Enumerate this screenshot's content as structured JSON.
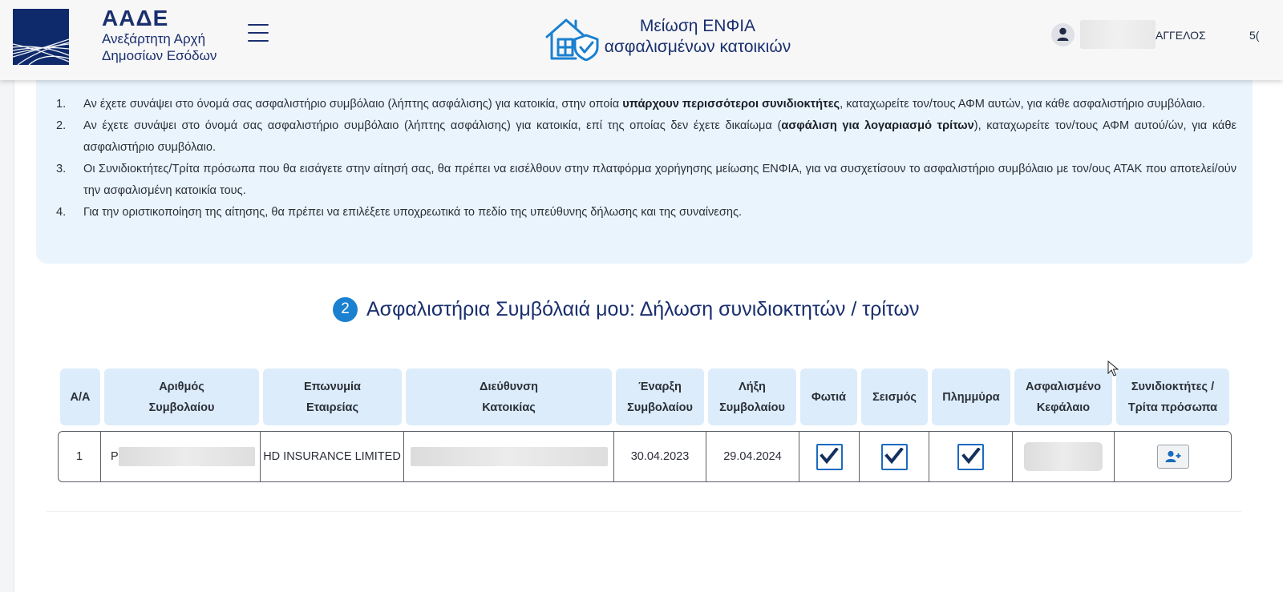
{
  "header": {
    "logo_title": "ΑΑΔΕ",
    "logo_sub1": "Ανεξάρτητη Αρχή",
    "logo_sub2": "Δημοσίων Εσόδων",
    "app_title_line1": "Μείωση ΕΝΦΙΑ",
    "app_title_line2": "ασφαλισμένων κατοικιών",
    "user_name": "ΑΓΓΕΛΟΣ",
    "user_extra": "5("
  },
  "info": {
    "items": [
      {
        "num": "1.",
        "pre": "Αν έχετε συνάψει στο όνομά σας ασφαλιστήριο συμβόλαιο (λήπτης ασφάλισης) για κατοικία, στην οποία ",
        "bold": "υπάρχουν περισσότεροι συνιδιοκτήτες",
        "post": ", καταχωρείτε τον/τους ΑΦΜ αυτών, για κάθε ασφαλιστήριο συμβόλαιο."
      },
      {
        "num": "2.",
        "pre": "Αν έχετε συνάψει στο όνομά σας ασφαλιστήριο συμβόλαιο (λήπτης ασφάλισης) για κατοικία, επί της οποίας δεν έχετε δικαίωμα (",
        "bold": "ασφάλιση για λογαριασμό τρίτων",
        "post": "), καταχωρείτε τον/τους ΑΦΜ αυτού/ών, για κάθε ασφαλιστήριο συμβόλαιο."
      },
      {
        "num": "3.",
        "text": "Οι Συνιδιοκτήτες/Τρίτα πρόσωπα που θα εισάγετε στην αίτησή σας, θα πρέπει να εισέλθουν στην πλατφόρμα χορήγησης μείωσης ΕΝΦΙΑ, για να συσχετίσουν το ασφαλιστήριο συμβόλαιο με τον/ους ΑΤΑΚ που αποτελεί/ούν την ασφαλισμένη κατοικία τους."
      },
      {
        "num": "4.",
        "text": "Για την οριστικοποίηση της αίτησης, θα πρέπει να επιλέξετε υποχρεωτικά το πεδίο της υπεύθυνης δήλωσης και της συναίνεσης."
      }
    ]
  },
  "section": {
    "step": "2",
    "title": "Ασφαλιστήρια Συμβόλαιά μου: Δήλωση συνιδιοκτητών / τρίτων"
  },
  "table": {
    "headers": [
      [
        "Α/Α"
      ],
      [
        "Αριθμός",
        "Συμβολαίου"
      ],
      [
        "Επωνυμία",
        "Εταιρείας"
      ],
      [
        "Διεύθυνση",
        "Κατοικίας"
      ],
      [
        "Έναρξη",
        "Συμβολαίου"
      ],
      [
        "Λήξη",
        "Συμβολαίου"
      ],
      [
        "Φωτιά"
      ],
      [
        "Σεισμός"
      ],
      [
        "Πλημμύρα"
      ],
      [
        "Ασφαλισμένο",
        "Κεφάλαιο"
      ],
      [
        "Συνιδιοκτήτες /",
        "Τρίτα πρόσωπα"
      ]
    ],
    "rows": [
      {
        "index": "1",
        "contract_prefix": "P",
        "company": "HD INSURANCE LIMITED",
        "start": "30.04.2023",
        "end": "29.04.2024",
        "fire": true,
        "earthquake": true,
        "flood": true
      }
    ]
  },
  "colors": {
    "brand": "#1a2f6e",
    "info_bg": "#e9f4fd",
    "header_cell_bg": "#dcecfb",
    "accent": "#1b80d0"
  }
}
